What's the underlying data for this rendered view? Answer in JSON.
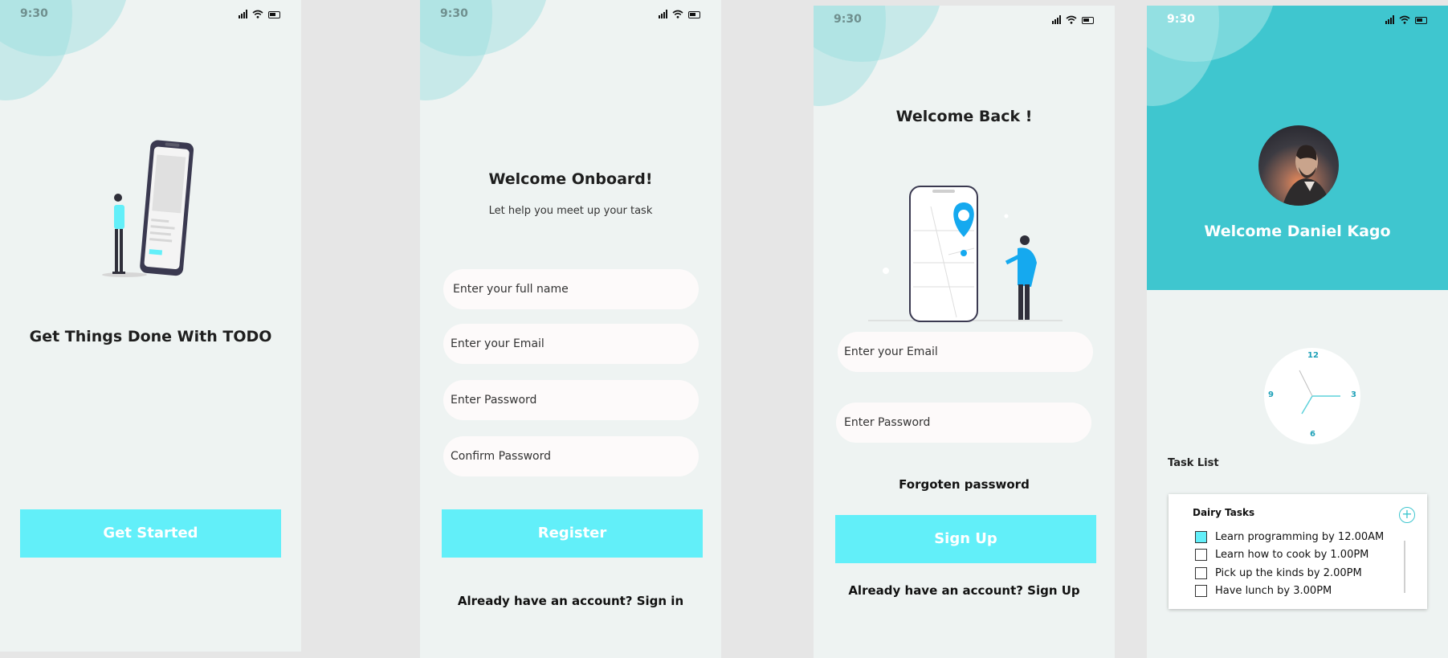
{
  "status": {
    "time": "9:30"
  },
  "icons": {
    "signal": "signal-icon",
    "wifi": "wifi-icon",
    "battery": "battery-icon"
  },
  "colors": {
    "accent": "#62eff9",
    "header": "#3fc6cf",
    "screen_bg": "#eef3f2",
    "canvas_bg": "#e6e6e6"
  },
  "screen1": {
    "title": "Get Things Done With TODO",
    "button_label": "Get Started"
  },
  "screen2": {
    "title": "Welcome Onboard!",
    "subtitle": "Let help you meet up your task",
    "fields": [
      {
        "placeholder": "Enter your full name"
      },
      {
        "placeholder": "Enter your Email"
      },
      {
        "placeholder": "Enter  Password"
      },
      {
        "placeholder": "Confirm Password"
      }
    ],
    "button_label": "Register",
    "account_prompt": "Already have an account?  Sign in"
  },
  "screen3": {
    "title": "Welcome Back !",
    "fields": [
      {
        "placeholder": "Enter your Email"
      },
      {
        "placeholder": "Enter  Password"
      }
    ],
    "forgot_label": "Forgoten password",
    "button_label": "Sign Up",
    "account_prompt": "Already have an account?  Sign Up"
  },
  "screen4": {
    "welcome": "Welcome Daniel  Kago",
    "clock_numbers": {
      "n12": "12",
      "n3": "3",
      "n6": "6",
      "n9": "9"
    },
    "tasklist_label": "Task List",
    "card_title": "Dairy Tasks",
    "add_symbol": "+",
    "tasks": [
      {
        "label": "Learn programming by 12.00AM",
        "checked": true
      },
      {
        "label": "Learn how to cook by 1.00PM",
        "checked": false
      },
      {
        "label": "Pick up the kinds by 2.00PM",
        "checked": false
      },
      {
        "label": "Have lunch by 3.00PM",
        "checked": false
      }
    ]
  }
}
